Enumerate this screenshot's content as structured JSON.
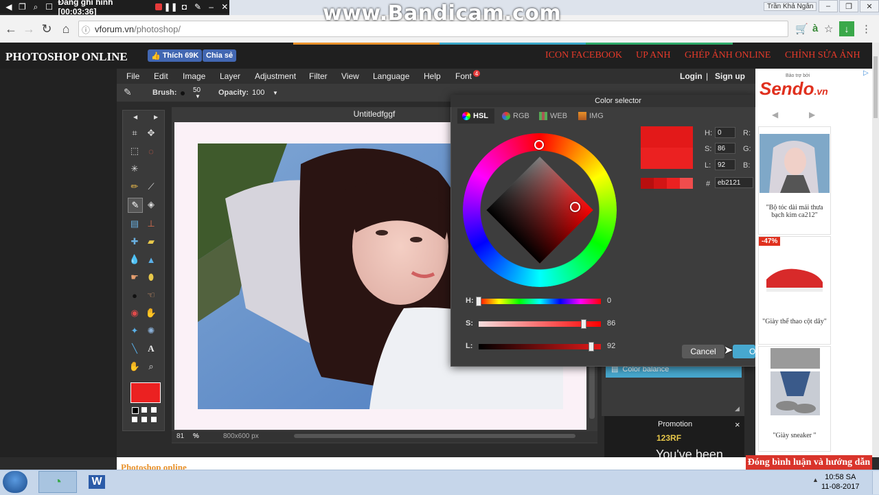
{
  "recorder": {
    "status": "Đang ghi hình [00:03:36]",
    "watermark": "www.Bandicam.com"
  },
  "browser": {
    "user": "Trần Khả Ngân",
    "url_host": "vforum.vn",
    "url_path": "/photoshop/"
  },
  "site": {
    "title": "PHOTOSHOP ONLINE",
    "like_label": "Thích 69K",
    "share_label": "Chia sẻ",
    "links": [
      "ICON FACEBOOK",
      "UP ANH",
      "GHÉP ẢNH ONLINE",
      "CHỈNH SỬA ẢNH"
    ]
  },
  "menu": {
    "items": [
      "File",
      "Edit",
      "Image",
      "Layer",
      "Adjustment",
      "Filter",
      "View",
      "Language",
      "Help",
      "Font"
    ],
    "font_badge": "4",
    "login": "Login",
    "separator": "|",
    "signup": "Sign up"
  },
  "options": {
    "brush_label": "Brush:",
    "brush_size": "50",
    "opacity_label": "Opacity:",
    "opacity_value": "100"
  },
  "document": {
    "title": "Untitledfggf",
    "zoom": "81",
    "zoom_unit": "%",
    "size": "800x600 px"
  },
  "colors": {
    "foreground": "#eb2121",
    "accent": "#47a8cf",
    "link_red": "#e53a2a"
  },
  "color_selector": {
    "title": "Color selector",
    "tabs": [
      "HSL",
      "RGB",
      "WEB",
      "IMG"
    ],
    "active_tab": "HSL",
    "h_label": "H:",
    "h_value": "0",
    "s_label": "S:",
    "s_value": "86",
    "l_label": "L:",
    "l_value": "92",
    "r_label": "R:",
    "g_label": "G:",
    "b_label": "B:",
    "hash": "#",
    "hex": "eb2121",
    "slider_h_label": "H:",
    "slider_s_label": "S:",
    "slider_l_label": "L:",
    "slider_h": 0,
    "slider_s": 86,
    "slider_l": 92,
    "cancel_label": "Cancel",
    "ok_label": "O"
  },
  "layers": {
    "item": "Color balance"
  },
  "promotion": {
    "title": "Promotion",
    "brand": "123RF",
    "text": "You've been",
    "close": "×"
  },
  "ad": {
    "brand": "Sendo",
    "brand_suffix": ".vn",
    "sponsor": "Bảo trợ bởi",
    "products": [
      {
        "caption": "\"Bộ tóc dài mái thưa bạch kim ca212\""
      },
      {
        "badge": "-47%",
        "caption": "\"Giày thể thao cột dây\""
      },
      {
        "caption": "\"Giày sneaker \""
      }
    ]
  },
  "footer": {
    "text": "Photoshop online",
    "chat": "Đóng bình luận và hướng dẫn"
  },
  "taskbar": {
    "time": "10:58 SA",
    "date": "11-08-2017"
  }
}
